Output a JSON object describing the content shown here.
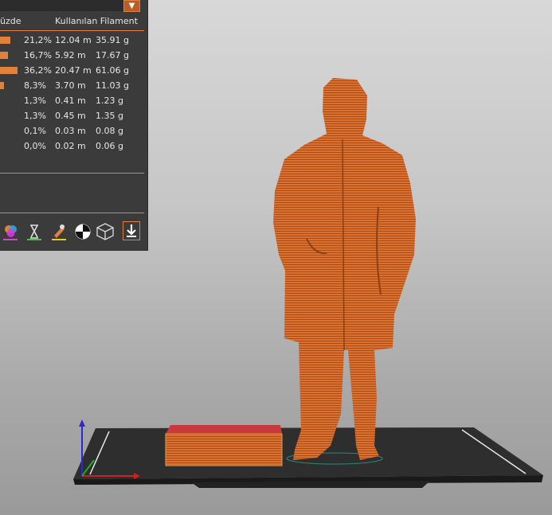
{
  "panel": {
    "columns": {
      "percent": "üzde",
      "used_filament": "Kullanılan Filament"
    },
    "rows": [
      {
        "percent": "21,2%",
        "length": "12.04 m",
        "weight": "35.91 g",
        "share": 0.212
      },
      {
        "percent": "16,7%",
        "length": "5.92 m",
        "weight": "17.67 g",
        "share": 0.167
      },
      {
        "percent": "36,2%",
        "length": "20.47 m",
        "weight": "61.06 g",
        "share": 0.362
      },
      {
        "percent": "8,3%",
        "length": "3.70 m",
        "weight": "11.03 g",
        "share": 0.083
      },
      {
        "percent": "1,3%",
        "length": "0.41 m",
        "weight": "1.23 g",
        "share": 0.013
      },
      {
        "percent": "1,3%",
        "length": "0.45 m",
        "weight": "1.35 g",
        "share": 0.013
      },
      {
        "percent": "0,1%",
        "length": "0.03 m",
        "weight": "0.08 g",
        "share": 0.001
      },
      {
        "percent": "0,0%",
        "length": "0.02 m",
        "weight": "0.06 g",
        "share": 0.0
      }
    ],
    "toolbar_icons": [
      "color-scheme-icon",
      "print-time-icon",
      "tool-change-icon",
      "center-of-mass-icon",
      "wireframe-icon",
      "export-gcode-icon"
    ]
  },
  "colors": {
    "accent": "#e0823e",
    "panel_bg": "#3b3b3b",
    "model": "#d96e2c",
    "prime_tower_top": "#c9383a",
    "bed": "#2b2b2b"
  }
}
